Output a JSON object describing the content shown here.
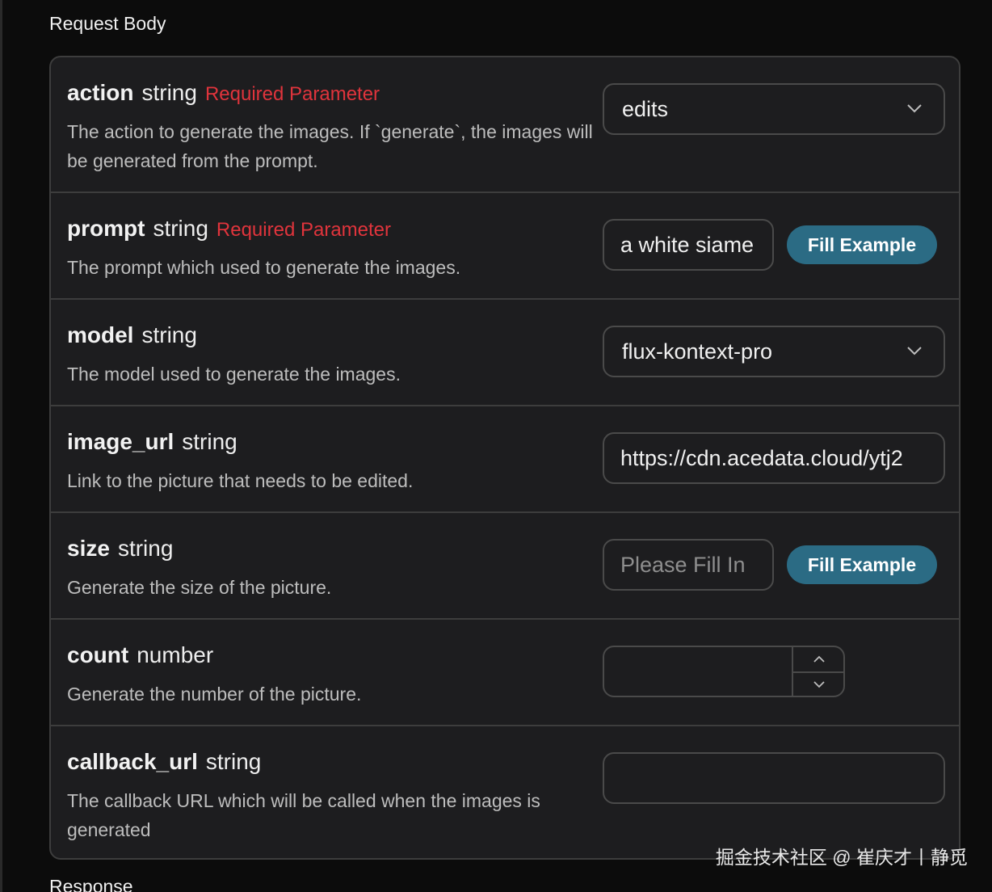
{
  "section_title": "Request Body",
  "next_section_title": "Response",
  "params": {
    "action": {
      "name": "action",
      "type": "string",
      "required": "Required Parameter",
      "description": "The action to generate the images. If `generate`, the images will be generated from the prompt.",
      "value": "edits",
      "chevron_icon": "chevron-down-icon"
    },
    "prompt": {
      "name": "prompt",
      "type": "string",
      "required": "Required Parameter",
      "description": "The prompt which used to generate the images.",
      "value": "a white siame",
      "button": "Fill Example"
    },
    "model": {
      "name": "model",
      "type": "string",
      "description": "The model used to generate the images.",
      "value": "flux-kontext-pro",
      "chevron_icon": "chevron-down-icon"
    },
    "image_url": {
      "name": "image_url",
      "type": "string",
      "description": "Link to the picture that needs to be edited.",
      "value": "https://cdn.acedata.cloud/ytj2"
    },
    "size": {
      "name": "size",
      "type": "string",
      "description": "Generate the size of the picture.",
      "placeholder": "Please Fill In",
      "button": "Fill Example"
    },
    "count": {
      "name": "count",
      "type": "number",
      "description": "Generate the number of the picture.",
      "value": ""
    },
    "callback_url": {
      "name": "callback_url",
      "type": "string",
      "description": "The callback URL which will be called when the images is generated",
      "value": ""
    }
  },
  "watermark": "掘金技术社区 @ 崔庆才丨静觅",
  "colors": {
    "background": "#0c0c0c",
    "panel": "#1d1d1f",
    "border": "#3d3d3d",
    "required": "#e0343c",
    "button": "#2b6b84"
  }
}
